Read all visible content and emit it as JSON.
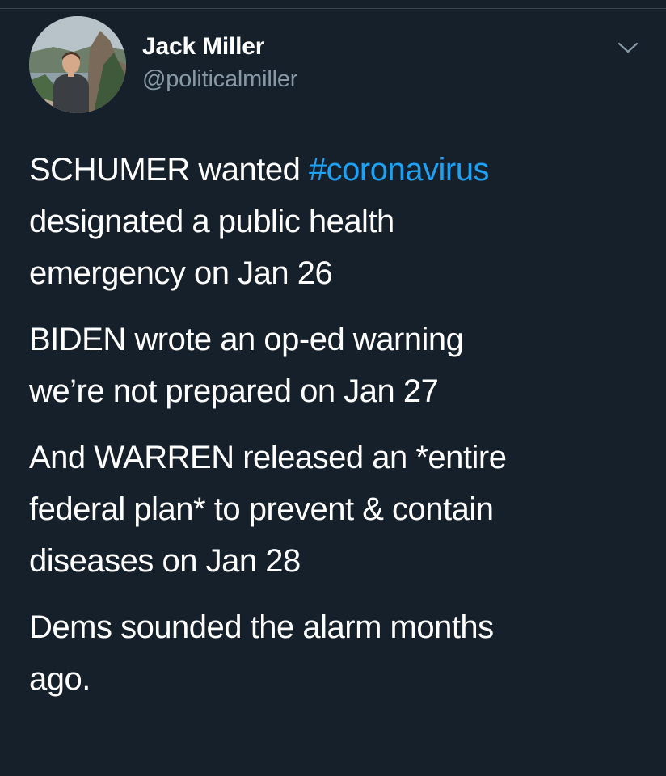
{
  "author": {
    "display_name": "Jack Miller",
    "handle": "@politicalmiller"
  },
  "tweet": {
    "line_1_before_hashtag": "SCHUMER wanted ",
    "hashtag": "#coronavirus",
    "line_2": "designated a public health",
    "line_3": "emergency on Jan 26",
    "line_4": "BIDEN wrote an op-ed warning",
    "line_5": "we’re not prepared on Jan 27",
    "line_6": "And WARREN released an *entire",
    "line_7": "federal plan* to prevent & contain",
    "line_8": "diseases on Jan 28",
    "line_9": "Dems sounded the alarm months",
    "line_10": "ago."
  },
  "icons": {
    "menu": "chevron-down-icon",
    "avatar": "avatar"
  },
  "colors": {
    "background": "#15202b",
    "text": "#ffffff",
    "secondary_text": "#8899a6",
    "link": "#1da1f2",
    "divider": "#38444d"
  }
}
